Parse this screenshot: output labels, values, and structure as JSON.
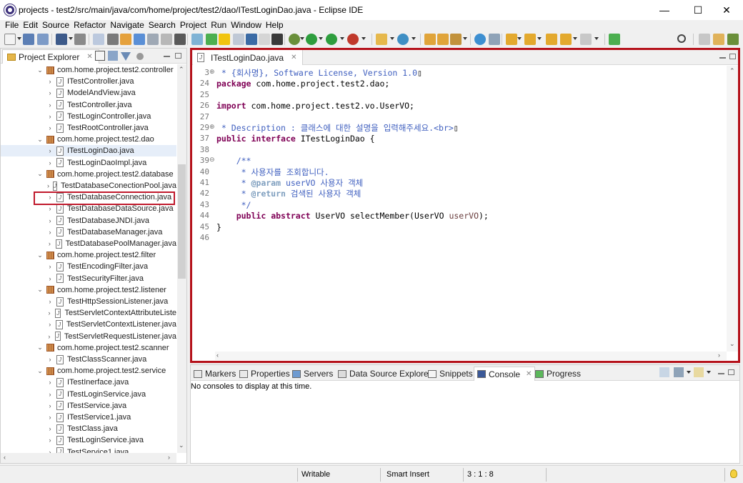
{
  "window": {
    "title": "projects - test2/src/main/java/com/home/project/test2/dao/ITestLoginDao.java - Eclipse IDE",
    "minimize_symbol": "—",
    "maximize_symbol": "☐",
    "close_symbol": "✕"
  },
  "menu": [
    "File",
    "Edit",
    "Source",
    "Refactor",
    "Navigate",
    "Search",
    "Project",
    "Run",
    "Window",
    "Help"
  ],
  "project_explorer": {
    "tab_label": "Project Explorer",
    "tree": [
      {
        "kind": "package",
        "label": "com.home.project.test2.controller",
        "expanded": true
      },
      {
        "kind": "iface",
        "label": "ITestController.java"
      },
      {
        "kind": "class",
        "label": "ModelAndView.java"
      },
      {
        "kind": "class",
        "label": "TestController.java"
      },
      {
        "kind": "class",
        "label": "TestLoginController.java"
      },
      {
        "kind": "class",
        "label": "TestRootController.java"
      },
      {
        "kind": "package",
        "label": "com.home.project.test2.dao",
        "expanded": true
      },
      {
        "kind": "iface",
        "label": "ITestLoginDao.java",
        "selected": true
      },
      {
        "kind": "class",
        "label": "TestLoginDaoImpl.java"
      },
      {
        "kind": "package",
        "label": "com.home.project.test2.database",
        "expanded": true
      },
      {
        "kind": "class",
        "label": "TestDatabaseConectionPool.java"
      },
      {
        "kind": "class",
        "label": "TestDatabaseConnection.java"
      },
      {
        "kind": "class",
        "label": "TestDatabaseDataSource.java"
      },
      {
        "kind": "class",
        "label": "TestDatabaseJNDI.java"
      },
      {
        "kind": "class",
        "label": "TestDatabaseManager.java"
      },
      {
        "kind": "class",
        "label": "TestDatabasePoolManager.java"
      },
      {
        "kind": "package",
        "label": "com.home.project.test2.filter",
        "expanded": true
      },
      {
        "kind": "class",
        "label": "TestEncodingFilter.java"
      },
      {
        "kind": "class",
        "label": "TestSecurityFilter.java"
      },
      {
        "kind": "package",
        "label": "com.home.project.test2.listener",
        "expanded": true
      },
      {
        "kind": "class",
        "label": "TestHttpSessionListener.java"
      },
      {
        "kind": "class",
        "label": "TestServletContextAttributeListe"
      },
      {
        "kind": "class",
        "label": "TestServletContextListener.java"
      },
      {
        "kind": "class",
        "label": "TestServletRequestListener.java"
      },
      {
        "kind": "package",
        "label": "com.home.project.test2.scanner",
        "expanded": true
      },
      {
        "kind": "class",
        "label": "TestClassScanner.java"
      },
      {
        "kind": "package",
        "label": "com.home.project.test2.service",
        "expanded": true
      },
      {
        "kind": "iface",
        "label": "ITestInerface.java"
      },
      {
        "kind": "iface",
        "label": "ITestLoginService.java"
      },
      {
        "kind": "iface",
        "label": "ITestService.java"
      },
      {
        "kind": "iface",
        "label": "ITestService1.java"
      },
      {
        "kind": "class",
        "label": "TestClass.java"
      },
      {
        "kind": "class",
        "label": "TestLoginService.java"
      },
      {
        "kind": "class",
        "label": "TestService1.java"
      }
    ]
  },
  "editor": {
    "tab_label": "ITestLoginDao.java",
    "line_numbers": [
      "3",
      "24",
      "25",
      "26",
      "27",
      "29",
      "37",
      "38",
      "39",
      "40",
      "41",
      "42",
      "43",
      "44",
      "45",
      "46"
    ],
    "code_lines": [
      [
        {
          "t": " * {회사명}, Software License, Version 1.0",
          "c": "cm"
        },
        {
          "t": "▯",
          "c": "txt"
        }
      ],
      [
        {
          "t": "package",
          "c": "kw"
        },
        {
          "t": " com.home.project.test2.dao;",
          "c": "txt"
        }
      ],
      [],
      [
        {
          "t": "import",
          "c": "kw"
        },
        {
          "t": " com.home.project.test2.vo.UserVO;",
          "c": "txt"
        }
      ],
      [],
      [
        {
          "t": " * Description : 클래스에 대한 설명을 입력해주세요.<br>",
          "c": "cm"
        },
        {
          "t": "▯",
          "c": "txt"
        }
      ],
      [
        {
          "t": "public",
          "c": "kw"
        },
        {
          "t": " ",
          "c": "txt"
        },
        {
          "t": "interface",
          "c": "kw"
        },
        {
          "t": " ITestLoginDao {",
          "c": "txt"
        }
      ],
      [],
      [
        {
          "t": "    /**",
          "c": "cm"
        }
      ],
      [
        {
          "t": "     * 사용자를 조회합니다.",
          "c": "cm"
        }
      ],
      [
        {
          "t": "     * ",
          "c": "cm"
        },
        {
          "t": "@param",
          "c": "tg"
        },
        {
          "t": " userVO 사용자 객체",
          "c": "cm"
        }
      ],
      [
        {
          "t": "     * ",
          "c": "cm"
        },
        {
          "t": "@return",
          "c": "tg"
        },
        {
          "t": " 검색된 사용자 객체",
          "c": "cm"
        }
      ],
      [
        {
          "t": "     */",
          "c": "cm"
        }
      ],
      [
        {
          "t": "    ",
          "c": "txt"
        },
        {
          "t": "public",
          "c": "kw"
        },
        {
          "t": " ",
          "c": "txt"
        },
        {
          "t": "abstract",
          "c": "kw"
        },
        {
          "t": " UserVO selectMember(UserVO ",
          "c": "txt"
        },
        {
          "t": "userVO",
          "c": "vr"
        },
        {
          "t": ");",
          "c": "txt"
        }
      ],
      [
        {
          "t": "}",
          "c": "txt"
        }
      ],
      []
    ],
    "fold_markers": [
      "⊕",
      "",
      "",
      "",
      "",
      "⊕",
      "",
      "",
      "⊖",
      "",
      "",
      "",
      "",
      "",
      "",
      ""
    ]
  },
  "bottom_panel": {
    "tabs": [
      "Markers",
      "Properties",
      "Servers",
      "Data Source Explorer",
      "Snippets",
      "Console",
      "Progress"
    ],
    "active_tab": "Console",
    "message": "No consoles to display at this time."
  },
  "status_bar": {
    "writable": "Writable",
    "insert_mode": "Smart Insert",
    "position": "3 : 1 : 8"
  },
  "colors": {
    "highlight_border": "#b5121b",
    "keyword": "#7f0055",
    "comment": "#3f5fbf"
  }
}
